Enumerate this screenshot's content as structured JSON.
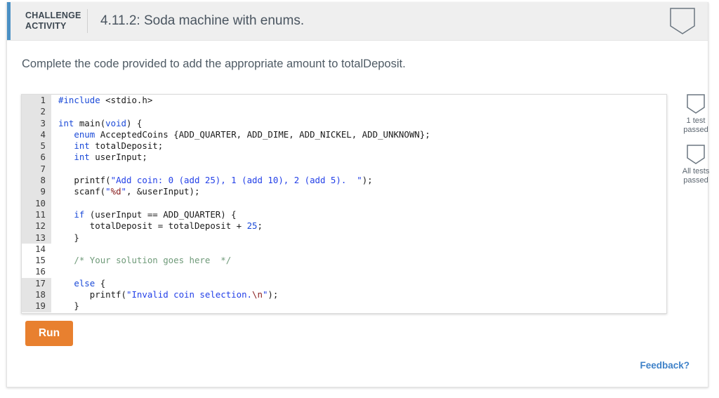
{
  "header": {
    "kicker": "CHALLENGE\nACTIVITY",
    "title": "4.11.2: Soda machine with enums.",
    "badge_icon": "shield-badge-icon",
    "accent_color": "#4a90c4"
  },
  "instruction": "Complete the code provided to add the appropriate amount to totalDeposit.",
  "editor": {
    "language": "c",
    "lines": [
      {
        "n": "1",
        "editable": false,
        "tokens": [
          {
            "t": "#include ",
            "c": "pre"
          },
          {
            "t": "<stdio.h>",
            "c": "plain"
          }
        ]
      },
      {
        "n": "2",
        "editable": false,
        "tokens": []
      },
      {
        "n": "3",
        "editable": false,
        "tokens": [
          {
            "t": "int",
            "c": "kw"
          },
          {
            "t": " main(",
            "c": "plain"
          },
          {
            "t": "void",
            "c": "kw"
          },
          {
            "t": ") {",
            "c": "plain"
          }
        ]
      },
      {
        "n": "4",
        "editable": false,
        "tokens": [
          {
            "t": "   ",
            "c": "plain"
          },
          {
            "t": "enum",
            "c": "kw"
          },
          {
            "t": " AcceptedCoins {ADD_QUARTER, ADD_DIME, ADD_NICKEL, ADD_UNKNOWN};",
            "c": "plain"
          }
        ]
      },
      {
        "n": "5",
        "editable": false,
        "tokens": [
          {
            "t": "   ",
            "c": "plain"
          },
          {
            "t": "int",
            "c": "kw"
          },
          {
            "t": " totalDeposit;",
            "c": "plain"
          }
        ]
      },
      {
        "n": "6",
        "editable": false,
        "tokens": [
          {
            "t": "   ",
            "c": "plain"
          },
          {
            "t": "int",
            "c": "kw"
          },
          {
            "t": " userInput;",
            "c": "plain"
          }
        ]
      },
      {
        "n": "7",
        "editable": false,
        "tokens": []
      },
      {
        "n": "8",
        "editable": false,
        "tokens": [
          {
            "t": "   printf(",
            "c": "plain"
          },
          {
            "t": "\"Add coin: 0 (add 25), 1 (add 10), 2 (add 5).  \"",
            "c": "str"
          },
          {
            "t": ");",
            "c": "plain"
          }
        ]
      },
      {
        "n": "9",
        "editable": false,
        "tokens": [
          {
            "t": "   scanf(",
            "c": "plain"
          },
          {
            "t": "\"",
            "c": "str"
          },
          {
            "t": "%d",
            "c": "esc"
          },
          {
            "t": "\"",
            "c": "str"
          },
          {
            "t": ", &userInput);",
            "c": "plain"
          }
        ]
      },
      {
        "n": "10",
        "editable": false,
        "tokens": []
      },
      {
        "n": "11",
        "editable": false,
        "tokens": [
          {
            "t": "   ",
            "c": "plain"
          },
          {
            "t": "if",
            "c": "kw"
          },
          {
            "t": " (userInput == ADD_QUARTER) {",
            "c": "plain"
          }
        ]
      },
      {
        "n": "12",
        "editable": false,
        "tokens": [
          {
            "t": "      totalDeposit = totalDeposit + ",
            "c": "plain"
          },
          {
            "t": "25",
            "c": "num"
          },
          {
            "t": ";",
            "c": "plain"
          }
        ]
      },
      {
        "n": "13",
        "editable": false,
        "tokens": [
          {
            "t": "   }",
            "c": "plain"
          }
        ]
      },
      {
        "n": "14",
        "editable": true,
        "tokens": []
      },
      {
        "n": "15",
        "editable": true,
        "tokens": [
          {
            "t": "   ",
            "c": "plain"
          },
          {
            "t": "/* Your solution goes here  */",
            "c": "cmt"
          }
        ]
      },
      {
        "n": "16",
        "editable": true,
        "tokens": []
      },
      {
        "n": "17",
        "editable": false,
        "tokens": [
          {
            "t": "   ",
            "c": "plain"
          },
          {
            "t": "else",
            "c": "kw"
          },
          {
            "t": " {",
            "c": "plain"
          }
        ]
      },
      {
        "n": "18",
        "editable": false,
        "tokens": [
          {
            "t": "      printf(",
            "c": "plain"
          },
          {
            "t": "\"Invalid coin selection.",
            "c": "str"
          },
          {
            "t": "\\n",
            "c": "esc"
          },
          {
            "t": "\"",
            "c": "str"
          },
          {
            "t": ");",
            "c": "plain"
          }
        ]
      },
      {
        "n": "19",
        "editable": false,
        "tokens": [
          {
            "t": "   }",
            "c": "plain"
          }
        ]
      }
    ]
  },
  "run_button": {
    "label": "Run",
    "color": "#e8802f"
  },
  "tests": [
    {
      "icon": "shield-badge-icon",
      "label": "1 test\npassed"
    },
    {
      "icon": "shield-badge-icon",
      "label": "All tests\npassed"
    }
  ],
  "feedback": {
    "label": "Feedback?",
    "color": "#3e81c8"
  }
}
